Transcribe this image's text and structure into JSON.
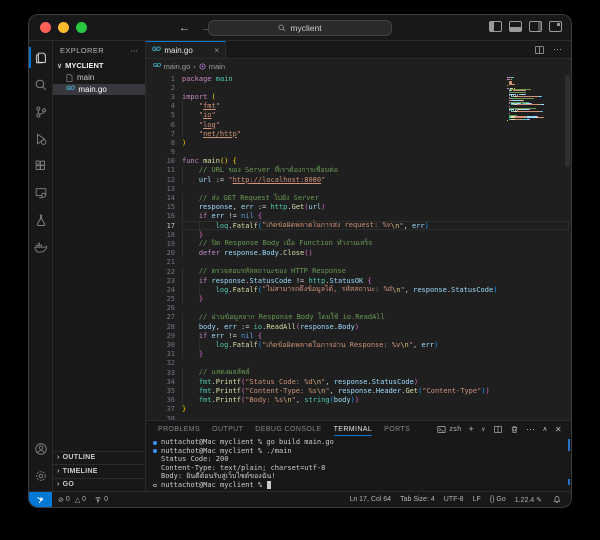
{
  "accent": "#0078d4",
  "title_bar": {
    "search_value": "myclient",
    "back_icon": "←",
    "forward_icon": "→"
  },
  "activity_bar": {
    "items": [
      "explorer",
      "search",
      "source-control",
      "run-debug",
      "extensions",
      "remote-explorer",
      "testing",
      "docker"
    ],
    "bottom_items": [
      "account",
      "settings"
    ],
    "active": "explorer"
  },
  "sidebar": {
    "header": "EXPLORER",
    "header_more": "⋯",
    "root": "MYCLIENT",
    "files": [
      {
        "name": "main",
        "icon": "binary",
        "selected": false
      },
      {
        "name": "main.go",
        "icon": "go",
        "selected": true
      }
    ],
    "sections": [
      "OUTLINE",
      "TIMELINE",
      "GO"
    ]
  },
  "editor": {
    "tab": {
      "label": "main.go",
      "close": "×"
    },
    "breadcrumbs": {
      "file": "main.go",
      "separator": "›",
      "symbol": "main"
    },
    "current_line": 17,
    "code_lines": [
      {
        "n": 1,
        "i": 0,
        "t": [
          [
            "kw",
            "package"
          ],
          [
            "pl",
            " "
          ],
          [
            "ns",
            "main"
          ]
        ]
      },
      {
        "n": 2,
        "i": 0,
        "t": []
      },
      {
        "n": 3,
        "i": 0,
        "t": [
          [
            "kw",
            "import"
          ],
          [
            "pl",
            " "
          ],
          [
            "b1",
            "("
          ]
        ]
      },
      {
        "n": 4,
        "i": 1,
        "t": [
          [
            "st",
            "\""
          ],
          [
            "stu",
            "fmt"
          ],
          [
            "st",
            "\""
          ]
        ]
      },
      {
        "n": 5,
        "i": 1,
        "t": [
          [
            "st",
            "\""
          ],
          [
            "stu",
            "io"
          ],
          [
            "st",
            "\""
          ]
        ]
      },
      {
        "n": 6,
        "i": 1,
        "t": [
          [
            "st",
            "\""
          ],
          [
            "stu",
            "log"
          ],
          [
            "st",
            "\""
          ]
        ]
      },
      {
        "n": 7,
        "i": 1,
        "t": [
          [
            "st",
            "\""
          ],
          [
            "stu",
            "net/http"
          ],
          [
            "st",
            "\""
          ]
        ]
      },
      {
        "n": 8,
        "i": 0,
        "t": [
          [
            "b1",
            ")"
          ]
        ]
      },
      {
        "n": 9,
        "i": 0,
        "t": []
      },
      {
        "n": 10,
        "i": 0,
        "t": [
          [
            "kw",
            "func"
          ],
          [
            "pl",
            " "
          ],
          [
            "fn",
            "main"
          ],
          [
            "b1",
            "()"
          ],
          [
            "pl",
            " "
          ],
          [
            "b1",
            "{"
          ]
        ]
      },
      {
        "n": 11,
        "i": 1,
        "t": [
          [
            "cm",
            "// URL ของ Server ที่เราต้องการเชื่อมต่อ"
          ]
        ]
      },
      {
        "n": 12,
        "i": 1,
        "t": [
          [
            "vr",
            "url"
          ],
          [
            "pl",
            " "
          ],
          [
            "op",
            ":="
          ],
          [
            "pl",
            " "
          ],
          [
            "st",
            "\""
          ],
          [
            "stu",
            "http://localhost:8080"
          ],
          [
            "st",
            "\""
          ]
        ]
      },
      {
        "n": 13,
        "i": 0,
        "t": []
      },
      {
        "n": 14,
        "i": 1,
        "t": [
          [
            "cm",
            "// ส่ง GET Request ไปยัง Server"
          ]
        ]
      },
      {
        "n": 15,
        "i": 1,
        "t": [
          [
            "vr",
            "response"
          ],
          [
            "pl",
            ", "
          ],
          [
            "vr",
            "err"
          ],
          [
            "pl",
            " "
          ],
          [
            "op",
            ":="
          ],
          [
            "pl",
            " "
          ],
          [
            "ns",
            "http"
          ],
          [
            "pl",
            "."
          ],
          [
            "fn",
            "Get"
          ],
          [
            "b2",
            "("
          ],
          [
            "vr",
            "url"
          ],
          [
            "b2",
            ")"
          ]
        ]
      },
      {
        "n": 16,
        "i": 1,
        "t": [
          [
            "kw",
            "if"
          ],
          [
            "pl",
            " "
          ],
          [
            "vr",
            "err"
          ],
          [
            "pl",
            " "
          ],
          [
            "op",
            "!="
          ],
          [
            "pl",
            " "
          ],
          [
            "kb",
            "nil"
          ],
          [
            "pl",
            " "
          ],
          [
            "b2",
            "{"
          ]
        ]
      },
      {
        "n": 17,
        "i": 2,
        "t": [
          [
            "ns",
            "log"
          ],
          [
            "pl",
            "."
          ],
          [
            "fn",
            "Fatalf"
          ],
          [
            "b3",
            "("
          ],
          [
            "st",
            "\"เกิดข้อผิดพลาดในการส่ง request: %v"
          ],
          [
            "es",
            "\\n"
          ],
          [
            "st",
            "\""
          ],
          [
            "pl",
            ", "
          ],
          [
            "vr",
            "err"
          ],
          [
            "b3",
            ")"
          ]
        ]
      },
      {
        "n": 18,
        "i": 1,
        "t": [
          [
            "b2",
            "}"
          ]
        ]
      },
      {
        "n": 19,
        "i": 1,
        "t": [
          [
            "cm",
            "// ปิด Response Body เมื่อ Function ทำงานเสร็จ"
          ]
        ]
      },
      {
        "n": 20,
        "i": 1,
        "t": [
          [
            "kw",
            "defer"
          ],
          [
            "pl",
            " "
          ],
          [
            "vr",
            "response"
          ],
          [
            "pl",
            "."
          ],
          [
            "vr",
            "Body"
          ],
          [
            "pl",
            "."
          ],
          [
            "fn",
            "Close"
          ],
          [
            "b2",
            "()"
          ]
        ]
      },
      {
        "n": 21,
        "i": 0,
        "t": []
      },
      {
        "n": 22,
        "i": 1,
        "t": [
          [
            "cm",
            "// ตรวจสอบรหัสสถานะของ HTTP Response"
          ]
        ]
      },
      {
        "n": 23,
        "i": 1,
        "t": [
          [
            "kw",
            "if"
          ],
          [
            "pl",
            " "
          ],
          [
            "vr",
            "response"
          ],
          [
            "pl",
            "."
          ],
          [
            "vr",
            "StatusCode"
          ],
          [
            "pl",
            " "
          ],
          [
            "op",
            "!="
          ],
          [
            "pl",
            " "
          ],
          [
            "ns",
            "http"
          ],
          [
            "pl",
            "."
          ],
          [
            "vr",
            "StatusOK"
          ],
          [
            "pl",
            " "
          ],
          [
            "b2",
            "{"
          ]
        ]
      },
      {
        "n": 24,
        "i": 2,
        "t": [
          [
            "ns",
            "log"
          ],
          [
            "pl",
            "."
          ],
          [
            "fn",
            "Fatalf"
          ],
          [
            "b3",
            "("
          ],
          [
            "st",
            "\"ไม่สามารถดึงข้อมูลได้, รหัสสถานะ: %d"
          ],
          [
            "es",
            "\\n"
          ],
          [
            "st",
            "\""
          ],
          [
            "pl",
            ", "
          ],
          [
            "vr",
            "response"
          ],
          [
            "pl",
            "."
          ],
          [
            "vr",
            "StatusCode"
          ],
          [
            "b3",
            ")"
          ]
        ]
      },
      {
        "n": 25,
        "i": 1,
        "t": [
          [
            "b2",
            "}"
          ]
        ]
      },
      {
        "n": 26,
        "i": 0,
        "t": []
      },
      {
        "n": 27,
        "i": 1,
        "t": [
          [
            "cm",
            "// อ่านข้อมูลจาก Response Body โดยใช้ io.ReadAll"
          ]
        ]
      },
      {
        "n": 28,
        "i": 1,
        "t": [
          [
            "vr",
            "body"
          ],
          [
            "pl",
            ", "
          ],
          [
            "vr",
            "err"
          ],
          [
            "pl",
            " "
          ],
          [
            "op",
            ":="
          ],
          [
            "pl",
            " "
          ],
          [
            "ns",
            "io"
          ],
          [
            "pl",
            "."
          ],
          [
            "fn",
            "ReadAll"
          ],
          [
            "b2",
            "("
          ],
          [
            "vr",
            "response"
          ],
          [
            "pl",
            "."
          ],
          [
            "vr",
            "Body"
          ],
          [
            "b2",
            ")"
          ]
        ]
      },
      {
        "n": 29,
        "i": 1,
        "t": [
          [
            "kw",
            "if"
          ],
          [
            "pl",
            " "
          ],
          [
            "vr",
            "err"
          ],
          [
            "pl",
            " "
          ],
          [
            "op",
            "!="
          ],
          [
            "pl",
            " "
          ],
          [
            "kb",
            "nil"
          ],
          [
            "pl",
            " "
          ],
          [
            "b2",
            "{"
          ]
        ]
      },
      {
        "n": 30,
        "i": 2,
        "t": [
          [
            "ns",
            "log"
          ],
          [
            "pl",
            "."
          ],
          [
            "fn",
            "Fatalf"
          ],
          [
            "b3",
            "("
          ],
          [
            "st",
            "\"เกิดข้อผิดพลาดในการอ่าน Response: %v"
          ],
          [
            "es",
            "\\n"
          ],
          [
            "st",
            "\""
          ],
          [
            "pl",
            ", "
          ],
          [
            "vr",
            "err"
          ],
          [
            "b3",
            ")"
          ]
        ]
      },
      {
        "n": 31,
        "i": 1,
        "t": [
          [
            "b2",
            "}"
          ]
        ]
      },
      {
        "n": 32,
        "i": 0,
        "t": []
      },
      {
        "n": 33,
        "i": 1,
        "t": [
          [
            "cm",
            "// แสดงผลลัพธ์"
          ]
        ]
      },
      {
        "n": 34,
        "i": 1,
        "t": [
          [
            "ns",
            "fmt"
          ],
          [
            "pl",
            "."
          ],
          [
            "fn",
            "Printf"
          ],
          [
            "b2",
            "("
          ],
          [
            "st",
            "\"Status Code: %d"
          ],
          [
            "es",
            "\\n"
          ],
          [
            "st",
            "\""
          ],
          [
            "pl",
            ", "
          ],
          [
            "vr",
            "response"
          ],
          [
            "pl",
            "."
          ],
          [
            "vr",
            "StatusCode"
          ],
          [
            "b2",
            ")"
          ]
        ]
      },
      {
        "n": 35,
        "i": 1,
        "t": [
          [
            "ns",
            "fmt"
          ],
          [
            "pl",
            "."
          ],
          [
            "fn",
            "Printf"
          ],
          [
            "b2",
            "("
          ],
          [
            "st",
            "\"Content-Type: %s"
          ],
          [
            "es",
            "\\n"
          ],
          [
            "st",
            "\""
          ],
          [
            "pl",
            ", "
          ],
          [
            "vr",
            "response"
          ],
          [
            "pl",
            "."
          ],
          [
            "vr",
            "Header"
          ],
          [
            "pl",
            "."
          ],
          [
            "fn",
            "Get"
          ],
          [
            "b3",
            "("
          ],
          [
            "st",
            "\"Content-Type\""
          ],
          [
            "b3",
            ")"
          ],
          [
            "b2",
            ")"
          ]
        ]
      },
      {
        "n": 36,
        "i": 1,
        "t": [
          [
            "ns",
            "fmt"
          ],
          [
            "pl",
            "."
          ],
          [
            "fn",
            "Printf"
          ],
          [
            "b2",
            "("
          ],
          [
            "st",
            "\"Body: %s"
          ],
          [
            "es",
            "\\n"
          ],
          [
            "st",
            "\""
          ],
          [
            "pl",
            ", "
          ],
          [
            "ns",
            "string"
          ],
          [
            "b3",
            "("
          ],
          [
            "vr",
            "body"
          ],
          [
            "b3",
            ")"
          ],
          [
            "b2",
            ")"
          ]
        ]
      },
      {
        "n": 37,
        "i": 0,
        "t": [
          [
            "b1",
            "}"
          ]
        ]
      },
      {
        "n": 38,
        "i": 0,
        "t": []
      }
    ]
  },
  "panel": {
    "tabs": [
      "PROBLEMS",
      "OUTPUT",
      "DEBUG CONSOLE",
      "TERMINAL",
      "PORTS"
    ],
    "active_tab": "TERMINAL",
    "shell_label": "zsh",
    "terminal_lines": [
      {
        "d": "run",
        "t": "nuttachot@Mac myclient % go build main.go"
      },
      {
        "d": "run",
        "t": "nuttachot@Mac myclient % ./main"
      },
      {
        "d": "",
        "t": "Status Code: 200"
      },
      {
        "d": "",
        "t": "Content-Type: text/plain; charset=utf-8"
      },
      {
        "d": "",
        "t": "Body: ยินดีต้อนรับสู่เว็บไซต์ของฉัน!"
      },
      {
        "d": "prompt",
        "t": "nuttachot@Mac myclient % ",
        "cursor": true
      }
    ]
  },
  "status_bar": {
    "errors": "0",
    "warnings": "0",
    "ports": "0",
    "right_items": [
      "Ln 17, Col 64",
      "Tab Size: 4",
      "UTF-8",
      "LF",
      "{} Go",
      "1.22.4 ✎"
    ]
  }
}
